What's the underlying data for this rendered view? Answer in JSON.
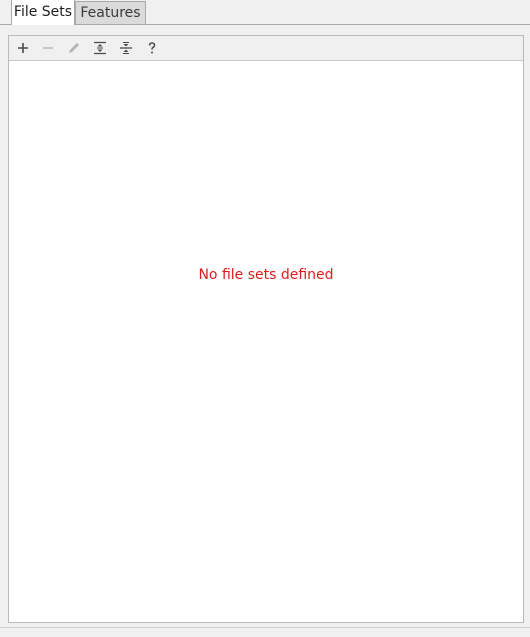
{
  "tabs": [
    {
      "label": "File Sets",
      "active": true
    },
    {
      "label": "Features",
      "active": false
    }
  ],
  "toolbar": {
    "buttons": [
      {
        "icon": "plus-icon",
        "enabled": true
      },
      {
        "icon": "minus-icon",
        "enabled": false
      },
      {
        "icon": "pencil-icon",
        "enabled": false
      },
      {
        "icon": "expand-all-icon",
        "enabled": true
      },
      {
        "icon": "collapse-all-icon",
        "enabled": true
      },
      {
        "icon": "help-icon",
        "enabled": true
      }
    ]
  },
  "content": {
    "empty_message": "No file sets defined"
  },
  "colors": {
    "empty_message": "#e01b1b",
    "icon_enabled": "#4a4a4a",
    "icon_disabled": "#b4b4b4"
  }
}
